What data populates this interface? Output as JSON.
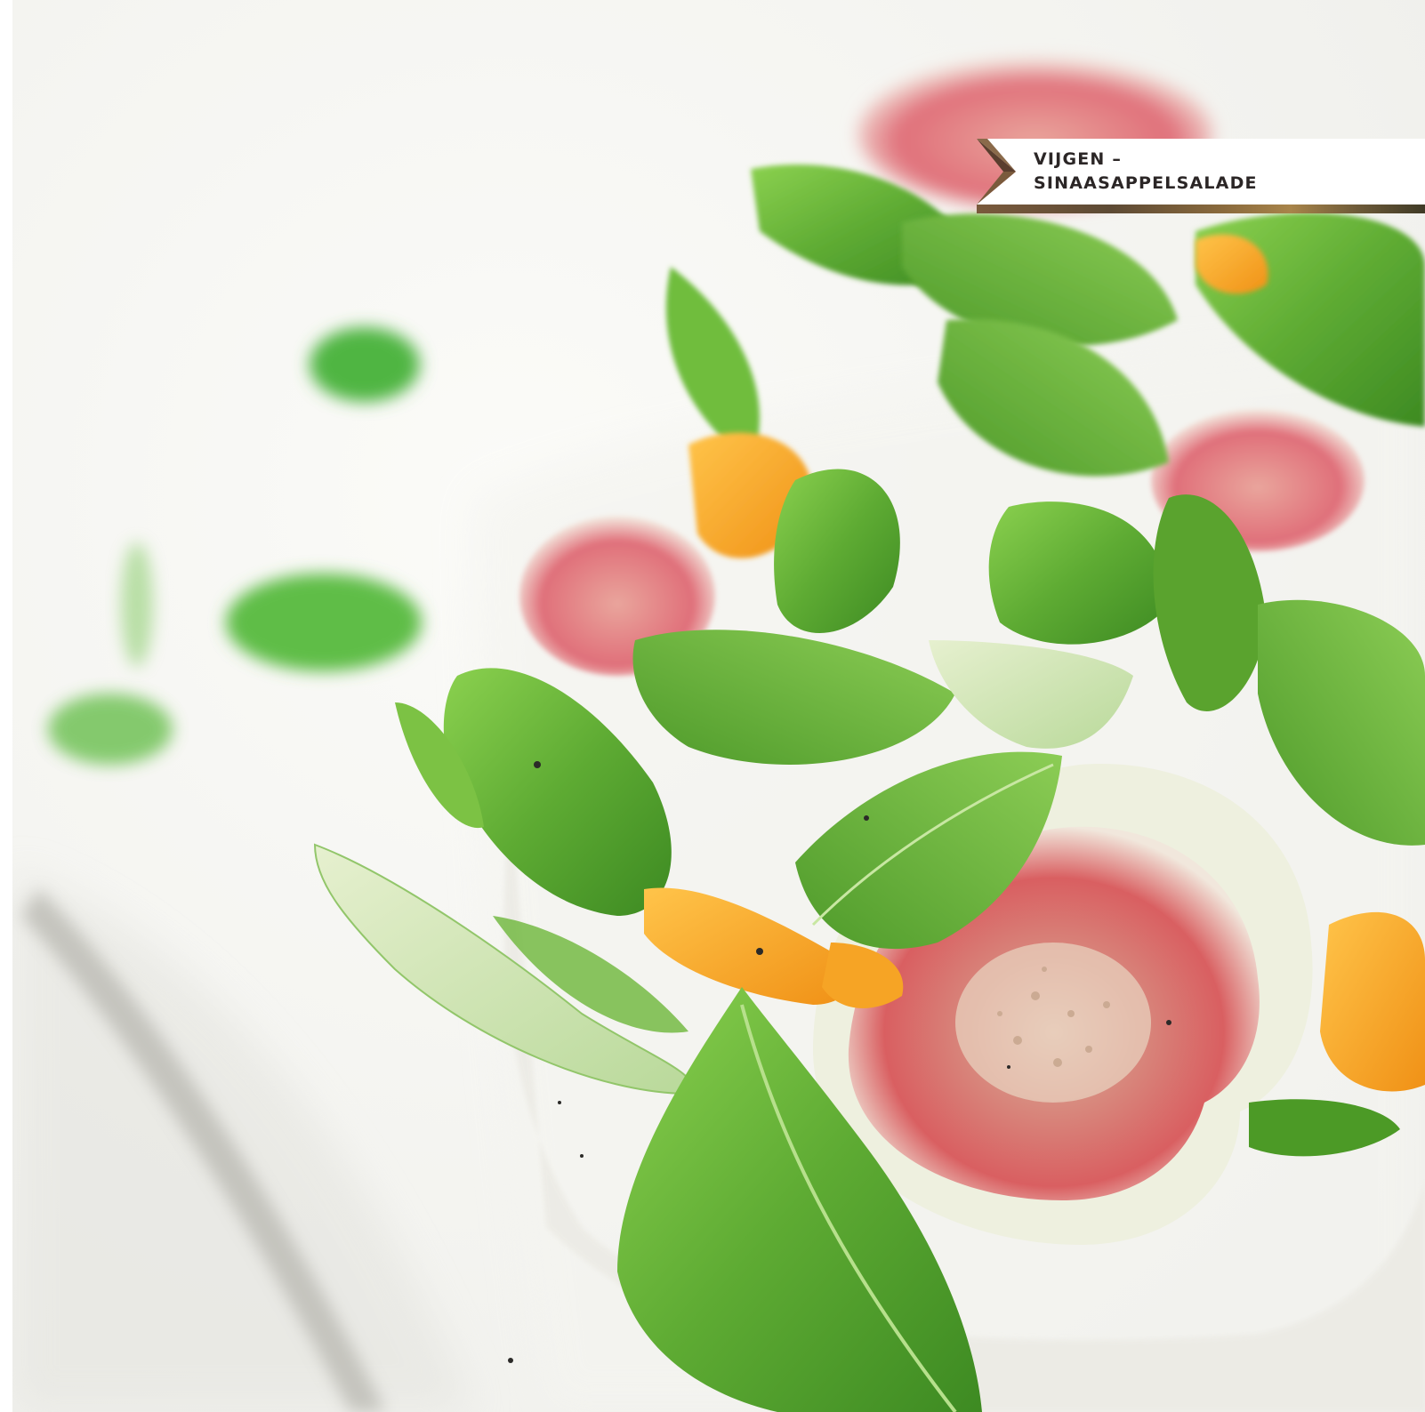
{
  "recipe_label": {
    "line1": "VIJGEN –",
    "line2": "SINAASAPPELSALADE"
  },
  "colors": {
    "label_text": "#2b2626",
    "ribbon_accent": "#7a5a3c",
    "leaf_green": "#5ca632",
    "fig_flesh": "#d9615e",
    "orange": "#f4a21e"
  }
}
